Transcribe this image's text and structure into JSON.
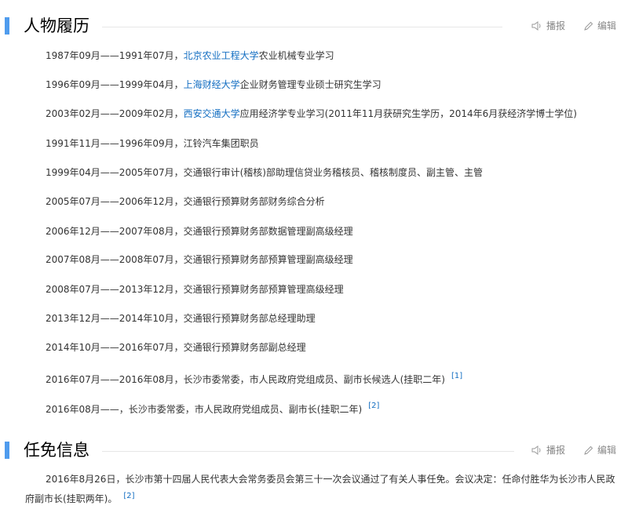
{
  "sections": {
    "career": {
      "title": "人物履历",
      "report": "播报",
      "edit": "编辑",
      "entries": [
        {
          "pre": "1987年09月——1991年07月，",
          "link": "北京农业工程大学",
          "post": "农业机械专业学习"
        },
        {
          "pre": "1996年09月——1999年04月，",
          "link": "上海财经大学",
          "post": "企业财务管理专业硕士研究生学习"
        },
        {
          "pre": "2003年02月——2009年02月，",
          "link": "西安交通大学",
          "post": "应用经济学专业学习(2011年11月获研究生学历，2014年6月获经济学博士学位)"
        },
        {
          "pre": "1991年11月——1996年09月，江铃汽车集团职员"
        },
        {
          "pre": "1999年04月——2005年07月，交通银行审计(稽核)部助理信贷业务稽核员、稽核制度员、副主管、主管"
        },
        {
          "pre": "2005年07月——2006年12月，交通银行预算财务部财务综合分析"
        },
        {
          "pre": "2006年12月——2007年08月，交通银行预算财务部数据管理副高级经理"
        },
        {
          "pre": "2007年08月——2008年07月，交通银行预算财务部预算管理副高级经理"
        },
        {
          "pre": "2008年07月——2013年12月，交通银行预算财务部预算管理高级经理"
        },
        {
          "pre": "2013年12月——2014年10月，交通银行预算财务部总经理助理"
        },
        {
          "pre": "2014年10月——2016年07月，交通银行预算财务部副总经理"
        },
        {
          "pre": "2016年07月——2016年08月，长沙市委常委，市人民政府党组成员、副市长候选人(挂职二年)",
          "ref": "[1]"
        },
        {
          "pre": "2016年08月——，长沙市委常委，市人民政府党组成员、副市长(挂职二年)",
          "ref": "[2]"
        }
      ]
    },
    "appointment": {
      "title": "任免信息",
      "report": "播报",
      "edit": "编辑",
      "text": "2016年8月26日，长沙市第十四届人民代表大会常务委员会第三十一次会议通过了有关人事任免。会议决定：任命付胜华为长沙市人民政府副市长(挂职两年)。",
      "ref": "[2]"
    }
  }
}
